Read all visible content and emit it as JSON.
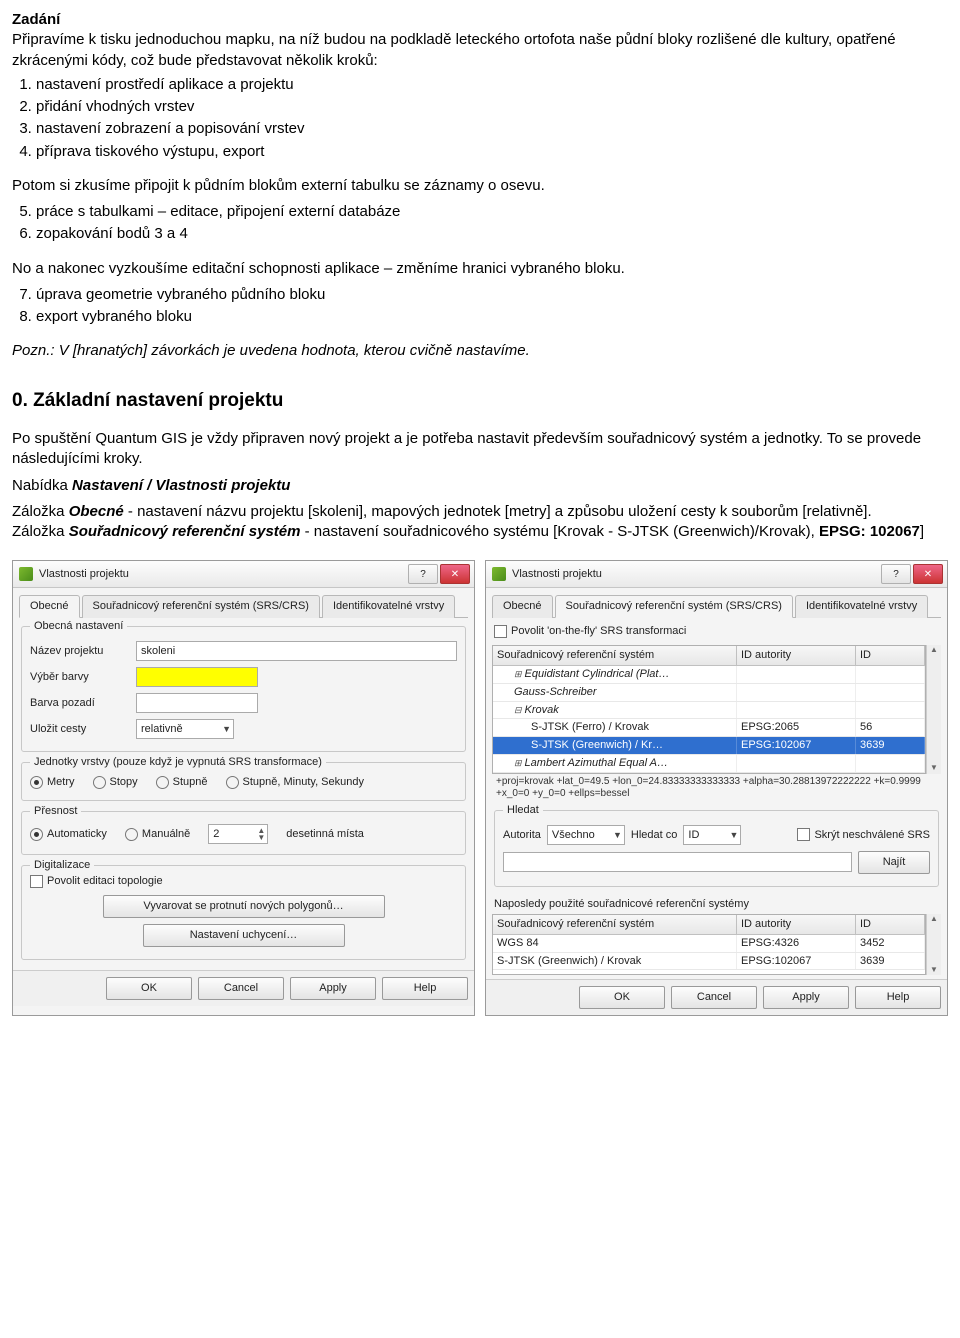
{
  "doc": {
    "zadani_heading": "Zadání",
    "intro": "Připravíme k tisku jednoduchou mapku, na níž budou na podkladě leteckého ortofota naše půdní bloky rozlišené dle kultury, opatřené zkrácenými kódy, což bude představovat několik kroků:",
    "list1": [
      "nastavení prostředí aplikace a projektu",
      "přidání vhodných vrstev",
      "nastavení zobrazení a popisování vrstev",
      "příprava tiskového výstupu, export"
    ],
    "middle_para": "Potom si zkusíme připojit k půdním blokům externí tabulku se záznamy o osevu.",
    "list2_start": 5,
    "list2": [
      "práce s tabulkami – editace, připojení externí databáze",
      "zopakování bodů 3 a 4"
    ],
    "para3": "No a nakonec vyzkoušíme editační schopnosti aplikace – změníme hranici vybraného bloku.",
    "list3_start": 7,
    "list3": [
      "úprava geometrie vybraného půdního bloku",
      "export vybraného bloku"
    ],
    "pozn": "Pozn.: V [hranatých] závorkách je uvedena hodnota, kterou cvičně nastavíme.",
    "h2": "0. Základní nastavení projektu",
    "para_after_h2": "Po spuštění Quantum GIS je vždy připraven nový projekt a je potřeba nastavit především souřadnicový systém a jednotky. To se provede následujícími kroky.",
    "menu_line_pre": "Nabídka ",
    "menu_line_bold": "Nastavení / Vlastnosti projektu",
    "obecne_pre": "Záložka ",
    "obecne_bold": "Obecné",
    "obecne_rest": " - nastavení názvu projektu [skoleni], mapových jednotek [metry] a způsobu uložení cesty k souborům [relativně].",
    "srs_pre": "Záložka ",
    "srs_bold": "Souřadnicový referenční systém",
    "srs_rest": " - nastavení souřadnicového systému [Krovak - S-JTSK (Greenwich)/Krovak), ",
    "srs_epsg_bold": "EPSG: 102067",
    "srs_close": "]"
  },
  "dialog1": {
    "title": "Vlastnosti projektu",
    "tabs": [
      "Obecné",
      "Souřadnicový referenční systém (SRS/CRS)",
      "Identifikovatelné vrstvy"
    ],
    "group_general": "Obecná nastavení",
    "lbl_name": "Název projektu",
    "val_name": "skoleni",
    "lbl_color": "Výběr barvy",
    "lbl_bg": "Barva pozadí",
    "lbl_paths": "Uložit cesty",
    "val_paths": "relativně",
    "group_units": "Jednotky vrstvy (pouze když je vypnutá SRS transformace)",
    "units": [
      "Metry",
      "Stopy",
      "Stupně",
      "Stupně, Minuty, Sekundy"
    ],
    "group_precision": "Přesnost",
    "precision_opts": [
      "Automaticky",
      "Manuálně"
    ],
    "spin_val": "2",
    "decimal_lbl": "desetinná místa",
    "group_digit": "Digitalizace",
    "chk_topo": "Povolit editaci topologie",
    "btn_warn": "Vyvarovat se protnutí nových polygonů…",
    "btn_snap": "Nastavení uchycení…",
    "ok": "OK",
    "cancel": "Cancel",
    "apply": "Apply",
    "help": "Help"
  },
  "dialog2": {
    "title": "Vlastnosti projektu",
    "tabs": [
      "Obecné",
      "Souřadnicový referenční systém (SRS/CRS)",
      "Identifikovatelné vrstvy"
    ],
    "chk_otf": "Povolit 'on-the-fly' SRS transformaci",
    "th_crs": "Souřadnicový referenční systém",
    "th_auth": "ID autority",
    "th_id": "ID",
    "tree": [
      {
        "indent": 1,
        "toggle": "⊞",
        "name": "Equidistant Cylindrical (Plat…",
        "italic": true
      },
      {
        "indent": 1,
        "toggle": "",
        "name": "Gauss-Schreiber",
        "italic": true
      },
      {
        "indent": 1,
        "toggle": "⊟",
        "name": "Krovak",
        "italic": true
      },
      {
        "indent": 2,
        "toggle": "",
        "name": "S-JTSK (Ferro) / Krovak",
        "auth": "EPSG:2065",
        "id": "56"
      },
      {
        "indent": 2,
        "toggle": "",
        "name": "S-JTSK (Greenwich) / Kr…",
        "auth": "EPSG:102067",
        "id": "3639",
        "selected": true
      },
      {
        "indent": 1,
        "toggle": "⊞",
        "name": "Lambert Azimuthal Equal A…",
        "italic": true
      }
    ],
    "proj_string": "+proj=krovak +lat_0=49.5 +lon_0=24.83333333333333 +alpha=30.28813972222222 +k=0.9999 +x_0=0 +y_0=0 +ellps=bessel",
    "group_find": "Hledat",
    "lbl_autorita": "Autorita",
    "val_autorita": "Všechno",
    "lbl_hledat": "Hledat co",
    "val_hledat": "ID",
    "chk_hide": "Skrýt neschválené SRS",
    "btn_find": "Najít",
    "recent_lbl": "Naposledy použité souřadnicové referenční systémy",
    "recent": [
      {
        "name": "WGS 84",
        "auth": "EPSG:4326",
        "id": "3452"
      },
      {
        "name": "S-JTSK (Greenwich) / Krovak",
        "auth": "EPSG:102067",
        "id": "3639"
      }
    ],
    "ok": "OK",
    "cancel": "Cancel",
    "apply": "Apply",
    "help": "Help"
  }
}
